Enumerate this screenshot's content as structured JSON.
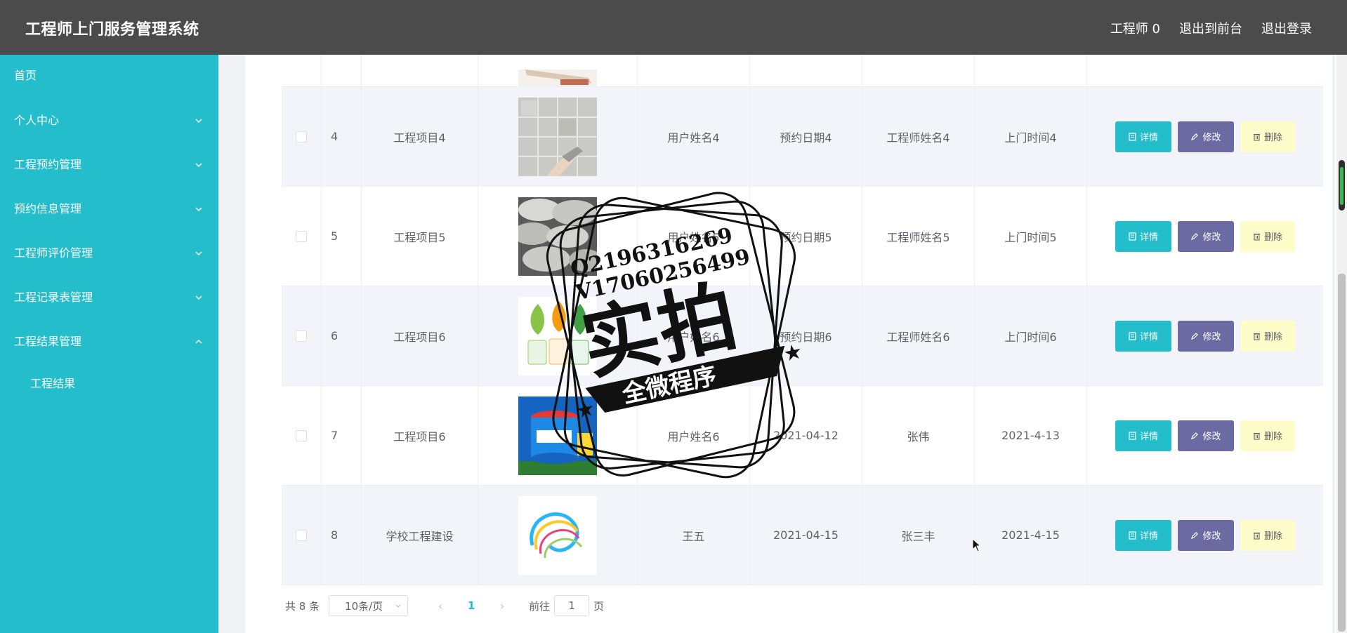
{
  "app": {
    "title": "工程师上门服务管理系统"
  },
  "top_actions": {
    "user": "工程师 0",
    "front": "退出到前台",
    "logout": "退出登录"
  },
  "sidebar": {
    "items": [
      {
        "label": "首页"
      },
      {
        "label": "个人中心"
      },
      {
        "label": "工程预约管理"
      },
      {
        "label": "预约信息管理"
      },
      {
        "label": "工程师评价管理"
      },
      {
        "label": "工程记录表管理"
      },
      {
        "label": "工程结果管理"
      }
    ],
    "sub_items": [
      {
        "label": "工程结果"
      }
    ]
  },
  "table": {
    "ops": {
      "detail": "详情",
      "edit": "修改",
      "delete": "删除"
    },
    "rows": [
      {
        "index": "4",
        "project": "工程项目4",
        "user": "用户姓名4",
        "date": "预约日期4",
        "engineer": "工程师姓名4",
        "visit": "上门时间4",
        "image": "tile"
      },
      {
        "index": "5",
        "project": "工程项目5",
        "user": "用户姓名5",
        "date": "预约日期5",
        "engineer": "工程师姓名5",
        "visit": "上门时间5",
        "image": "cement-bags"
      },
      {
        "index": "6",
        "project": "工程项目6",
        "user": "用户姓名6",
        "date": "预约日期6",
        "engineer": "工程师姓名6",
        "visit": "上门时间6",
        "image": "paint-cans"
      },
      {
        "index": "7",
        "project": "工程项目6",
        "user": "用户姓名6",
        "date": "2021-04-12",
        "engineer": "张伟",
        "visit": "2021-4-13",
        "image": "paint-bucket"
      },
      {
        "index": "8",
        "project": "学校工程建设",
        "user": "王五",
        "date": "2021-04-15",
        "engineer": "张三丰",
        "visit": "2021-4-15",
        "image": "swirl"
      }
    ]
  },
  "pagination": {
    "total": "共 8 条",
    "page_size": "10条/页",
    "current": "1",
    "goto_label": "前往",
    "goto_value": "1",
    "page_suffix": "页"
  },
  "watermark": {
    "line1": "Q2196316269",
    "line2": "V17060256499",
    "main": "实拍",
    "banner": "全微程序"
  },
  "colors": {
    "topbar": "#4b4b4b",
    "sidebar": "#23bdcb",
    "detail": "#23bdcb",
    "edit": "#6c6aa3",
    "delete": "#fefcc8"
  }
}
